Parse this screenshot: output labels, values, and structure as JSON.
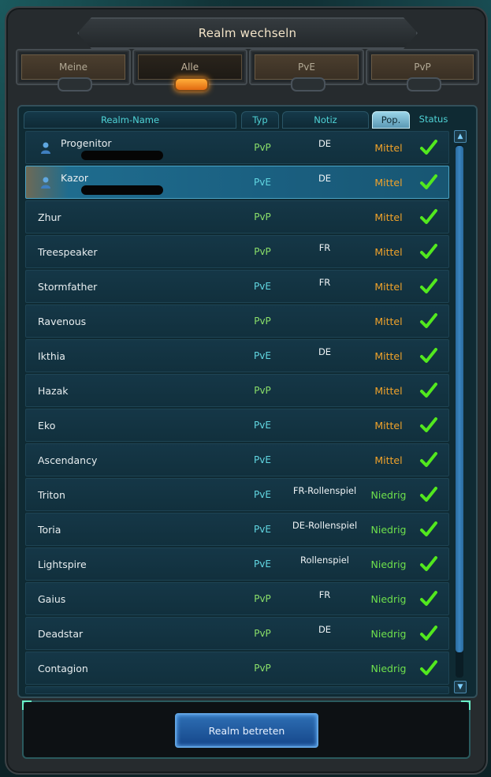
{
  "title": "Realm wechseln",
  "tabs": [
    {
      "label": "Meine",
      "active": false
    },
    {
      "label": "Alle",
      "active": true
    },
    {
      "label": "PvE",
      "active": false
    },
    {
      "label": "PvP",
      "active": false
    }
  ],
  "columns": {
    "name": "Realm-Name",
    "type": "Typ",
    "note": "Notiz",
    "pop": "Pop.",
    "status": "Status"
  },
  "realms": [
    {
      "name": "Progenitor",
      "type": "PvP",
      "note": "DE",
      "pop": "Mittel",
      "pop_level": "mid",
      "status": "online",
      "has_characters": true,
      "selected": false
    },
    {
      "name": "Kazor",
      "type": "PvE",
      "note": "DE",
      "pop": "Mittel",
      "pop_level": "mid",
      "status": "online",
      "has_characters": true,
      "selected": true
    },
    {
      "name": "Zhur",
      "type": "PvP",
      "note": "",
      "pop": "Mittel",
      "pop_level": "mid",
      "status": "online",
      "has_characters": false,
      "selected": false
    },
    {
      "name": "Treespeaker",
      "type": "PvP",
      "note": "FR",
      "pop": "Mittel",
      "pop_level": "mid",
      "status": "online",
      "has_characters": false,
      "selected": false
    },
    {
      "name": "Stormfather",
      "type": "PvE",
      "note": "FR",
      "pop": "Mittel",
      "pop_level": "mid",
      "status": "online",
      "has_characters": false,
      "selected": false
    },
    {
      "name": "Ravenous",
      "type": "PvP",
      "note": "",
      "pop": "Mittel",
      "pop_level": "mid",
      "status": "online",
      "has_characters": false,
      "selected": false
    },
    {
      "name": "Ikthia",
      "type": "PvE",
      "note": "DE",
      "pop": "Mittel",
      "pop_level": "mid",
      "status": "online",
      "has_characters": false,
      "selected": false
    },
    {
      "name": "Hazak",
      "type": "PvP",
      "note": "",
      "pop": "Mittel",
      "pop_level": "mid",
      "status": "online",
      "has_characters": false,
      "selected": false
    },
    {
      "name": "Eko",
      "type": "PvE",
      "note": "",
      "pop": "Mittel",
      "pop_level": "mid",
      "status": "online",
      "has_characters": false,
      "selected": false
    },
    {
      "name": "Ascendancy",
      "type": "PvE",
      "note": "",
      "pop": "Mittel",
      "pop_level": "mid",
      "status": "online",
      "has_characters": false,
      "selected": false
    },
    {
      "name": "Triton",
      "type": "PvE",
      "note": "FR-Rollenspiel",
      "pop": "Niedrig",
      "pop_level": "low",
      "status": "online",
      "has_characters": false,
      "selected": false
    },
    {
      "name": "Toria",
      "type": "PvE",
      "note": "DE-Rollenspiel",
      "pop": "Niedrig",
      "pop_level": "low",
      "status": "online",
      "has_characters": false,
      "selected": false
    },
    {
      "name": "Lightspire",
      "type": "PvE",
      "note": "Rollenspiel",
      "pop": "Niedrig",
      "pop_level": "low",
      "status": "online",
      "has_characters": false,
      "selected": false
    },
    {
      "name": "Gaius",
      "type": "PvP",
      "note": "FR",
      "pop": "Niedrig",
      "pop_level": "low",
      "status": "online",
      "has_characters": false,
      "selected": false
    },
    {
      "name": "Deadstar",
      "type": "PvP",
      "note": "DE",
      "pop": "Niedrig",
      "pop_level": "low",
      "status": "online",
      "has_characters": false,
      "selected": false
    },
    {
      "name": "Contagion",
      "type": "PvP",
      "note": "",
      "pop": "Niedrig",
      "pop_level": "low",
      "status": "online",
      "has_characters": false,
      "selected": false
    }
  ],
  "footer": {
    "enter_button": "Realm betreten"
  },
  "colors": {
    "pop_mid": "#f0a22a",
    "pop_low": "#6ee04c",
    "type_pvp": "#8be06a",
    "type_pve": "#62d7e2",
    "check": "#52e81e"
  }
}
